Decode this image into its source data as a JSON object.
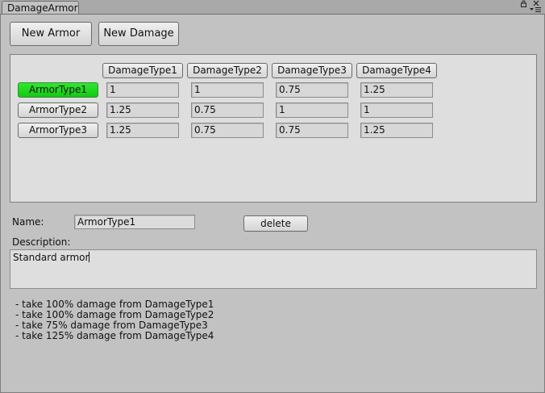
{
  "window": {
    "tab_title": "DamageArmor",
    "lock_icon": "lock-icon",
    "close_icon": "close-icon",
    "menu_icon": "menu-icon"
  },
  "toolbar": {
    "new_armor_label": "New Armor",
    "new_damage_label": "New Damage"
  },
  "grid": {
    "damage_types": [
      "DamageType1",
      "DamageType2",
      "DamageType3",
      "DamageType4"
    ],
    "armor_rows": [
      {
        "label": "ArmorType1",
        "selected": true,
        "values": [
          "1",
          "1",
          "0.75",
          "1.25"
        ]
      },
      {
        "label": "ArmorType2",
        "selected": false,
        "values": [
          "1.25",
          "0.75",
          "1",
          "1"
        ]
      },
      {
        "label": "ArmorType3",
        "selected": false,
        "values": [
          "1.25",
          "0.75",
          "0.75",
          "1.25"
        ]
      }
    ],
    "selected_color": "#1fd81f"
  },
  "editor": {
    "name_label": "Name:",
    "name_value": "ArmorType1",
    "delete_label": "delete",
    "description_label": "Description:",
    "description_value": "Standard armor"
  },
  "summary": {
    "lines": [
      "- take 100% damage from DamageType1",
      "- take 100% damage from DamageType2",
      "- take 75% damage from DamageType3",
      "- take 125% damage from DamageType4"
    ]
  }
}
